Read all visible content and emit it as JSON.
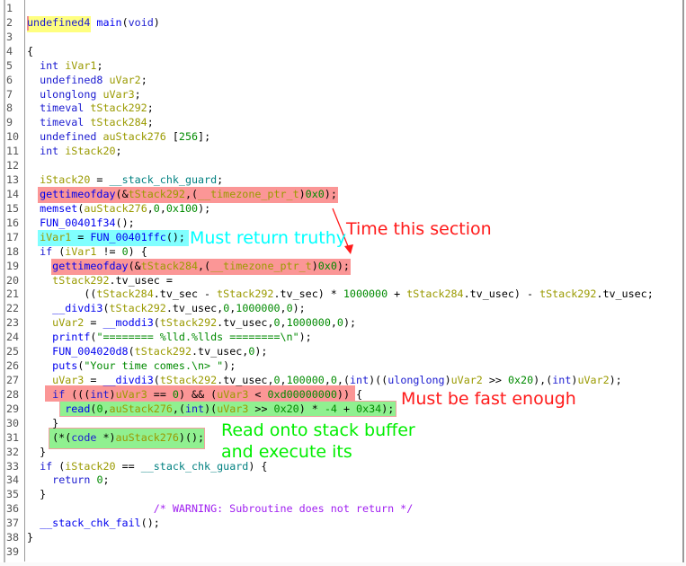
{
  "colors": {
    "keyword": "#1b1bd0",
    "function": "#0000ee",
    "variable": "#9a9a00",
    "number": "#008a00",
    "global": "#008080",
    "comment": "#a020f0",
    "note_red": "#ff1a1a",
    "note_cyan": "#00ffff",
    "note_green": "#00ee00"
  },
  "lines": [
    [],
    [
      [
        "k",
        "undefined4"
      ],
      [
        "p",
        " "
      ],
      [
        "f",
        "main"
      ],
      [
        "p",
        "("
      ],
      [
        "k",
        "void"
      ],
      [
        "p",
        ")"
      ]
    ],
    [],
    [
      [
        "p",
        "{"
      ]
    ],
    [
      [
        "p",
        "  "
      ],
      [
        "k",
        "int"
      ],
      [
        "p",
        " "
      ],
      [
        "v",
        "iVar1"
      ],
      [
        "p",
        ";"
      ]
    ],
    [
      [
        "p",
        "  "
      ],
      [
        "k",
        "undefined8"
      ],
      [
        "p",
        " "
      ],
      [
        "v",
        "uVar2"
      ],
      [
        "p",
        ";"
      ]
    ],
    [
      [
        "p",
        "  "
      ],
      [
        "k",
        "ulonglong"
      ],
      [
        "p",
        " "
      ],
      [
        "v",
        "uVar3"
      ],
      [
        "p",
        ";"
      ]
    ],
    [
      [
        "p",
        "  "
      ],
      [
        "k",
        "timeval"
      ],
      [
        "p",
        " "
      ],
      [
        "v",
        "tStack292"
      ],
      [
        "p",
        ";"
      ]
    ],
    [
      [
        "p",
        "  "
      ],
      [
        "k",
        "timeval"
      ],
      [
        "p",
        " "
      ],
      [
        "v",
        "tStack284"
      ],
      [
        "p",
        ";"
      ]
    ],
    [
      [
        "p",
        "  "
      ],
      [
        "k",
        "undefined"
      ],
      [
        "p",
        " "
      ],
      [
        "v",
        "auStack276"
      ],
      [
        "p",
        " ["
      ],
      [
        "n",
        "256"
      ],
      [
        "p",
        "];"
      ]
    ],
    [
      [
        "p",
        "  "
      ],
      [
        "k",
        "int"
      ],
      [
        "p",
        " "
      ],
      [
        "v",
        "iStack20"
      ],
      [
        "p",
        ";"
      ]
    ],
    [],
    [
      [
        "p",
        "  "
      ],
      [
        "v",
        "iStack20"
      ],
      [
        "p",
        " = "
      ],
      [
        "g",
        "__stack_chk_guard"
      ],
      [
        "p",
        ";"
      ]
    ],
    [
      [
        "p",
        "  "
      ],
      [
        "f",
        "gettimeofday"
      ],
      [
        "p",
        "(&"
      ],
      [
        "v",
        "tStack292"
      ],
      [
        "p",
        ",("
      ],
      [
        "v",
        "__timezone_ptr_t"
      ],
      [
        "p",
        ")"
      ],
      [
        "n",
        "0x0"
      ],
      [
        "p",
        ");"
      ]
    ],
    [
      [
        "p",
        "  "
      ],
      [
        "f",
        "memset"
      ],
      [
        "p",
        "("
      ],
      [
        "v",
        "auStack276"
      ],
      [
        "p",
        ","
      ],
      [
        "n",
        "0"
      ],
      [
        "p",
        ","
      ],
      [
        "n",
        "0x100"
      ],
      [
        "p",
        ");"
      ]
    ],
    [
      [
        "p",
        "  "
      ],
      [
        "f",
        "FUN_00401f34"
      ],
      [
        "p",
        "();"
      ]
    ],
    [
      [
        "p",
        "  "
      ],
      [
        "v",
        "iVar1"
      ],
      [
        "p",
        " = "
      ],
      [
        "f",
        "FUN_00401ffc"
      ],
      [
        "p",
        "();"
      ]
    ],
    [
      [
        "p",
        "  "
      ],
      [
        "k",
        "if"
      ],
      [
        "p",
        " ("
      ],
      [
        "v",
        "iVar1"
      ],
      [
        "p",
        " != "
      ],
      [
        "n",
        "0"
      ],
      [
        "p",
        ") {"
      ]
    ],
    [
      [
        "p",
        "    "
      ],
      [
        "f",
        "gettimeofday"
      ],
      [
        "p",
        "(&"
      ],
      [
        "v",
        "tStack284"
      ],
      [
        "p",
        ",("
      ],
      [
        "v",
        "__timezone_ptr_t"
      ],
      [
        "p",
        ")"
      ],
      [
        "n",
        "0x0"
      ],
      [
        "p",
        ");"
      ]
    ],
    [
      [
        "p",
        "    "
      ],
      [
        "v",
        "tStack292"
      ],
      [
        "p",
        ".tv_usec ="
      ]
    ],
    [
      [
        "p",
        "         (("
      ],
      [
        "v",
        "tStack284"
      ],
      [
        "p",
        ".tv_sec - "
      ],
      [
        "v",
        "tStack292"
      ],
      [
        "p",
        ".tv_sec) * "
      ],
      [
        "n",
        "1000000"
      ],
      [
        "p",
        " + "
      ],
      [
        "v",
        "tStack284"
      ],
      [
        "p",
        ".tv_usec) - "
      ],
      [
        "v",
        "tStack292"
      ],
      [
        "p",
        ".tv_usec;"
      ]
    ],
    [
      [
        "p",
        "    "
      ],
      [
        "f",
        "__divdi3"
      ],
      [
        "p",
        "("
      ],
      [
        "v",
        "tStack292"
      ],
      [
        "p",
        ".tv_usec,"
      ],
      [
        "n",
        "0"
      ],
      [
        "p",
        ","
      ],
      [
        "n",
        "1000000"
      ],
      [
        "p",
        ","
      ],
      [
        "n",
        "0"
      ],
      [
        "p",
        ");"
      ]
    ],
    [
      [
        "p",
        "    "
      ],
      [
        "v",
        "uVar2"
      ],
      [
        "p",
        " = "
      ],
      [
        "f",
        "__moddi3"
      ],
      [
        "p",
        "("
      ],
      [
        "v",
        "tStack292"
      ],
      [
        "p",
        ".tv_usec,"
      ],
      [
        "n",
        "0"
      ],
      [
        "p",
        ","
      ],
      [
        "n",
        "1000000"
      ],
      [
        "p",
        ","
      ],
      [
        "n",
        "0"
      ],
      [
        "p",
        ");"
      ]
    ],
    [
      [
        "p",
        "    "
      ],
      [
        "f",
        "printf"
      ],
      [
        "p",
        "("
      ],
      [
        "s",
        "\"======== %lld.%llds ========\\n\""
      ],
      [
        "p",
        ");"
      ]
    ],
    [
      [
        "p",
        "    "
      ],
      [
        "f",
        "FUN_004020d8"
      ],
      [
        "p",
        "("
      ],
      [
        "v",
        "tStack292"
      ],
      [
        "p",
        ".tv_usec,"
      ],
      [
        "n",
        "0"
      ],
      [
        "p",
        ");"
      ]
    ],
    [
      [
        "p",
        "    "
      ],
      [
        "f",
        "puts"
      ],
      [
        "p",
        "("
      ],
      [
        "s",
        "\"Your time comes.\\n> \""
      ],
      [
        "p",
        ");"
      ]
    ],
    [
      [
        "p",
        "    "
      ],
      [
        "v",
        "uVar3"
      ],
      [
        "p",
        " = "
      ],
      [
        "f",
        "__divdi3"
      ],
      [
        "p",
        "("
      ],
      [
        "v",
        "tStack292"
      ],
      [
        "p",
        ".tv_usec,"
      ],
      [
        "n",
        "0"
      ],
      [
        "p",
        ","
      ],
      [
        "n",
        "100000"
      ],
      [
        "p",
        ","
      ],
      [
        "n",
        "0"
      ],
      [
        "p",
        ",("
      ],
      [
        "k",
        "int"
      ],
      [
        "p",
        ")(("
      ],
      [
        "k",
        "ulonglong"
      ],
      [
        "p",
        ")"
      ],
      [
        "v",
        "uVar2"
      ],
      [
        "p",
        " >> "
      ],
      [
        "n",
        "0x20"
      ],
      [
        "p",
        "),("
      ],
      [
        "k",
        "int"
      ],
      [
        "p",
        ")"
      ],
      [
        "v",
        "uVar2"
      ],
      [
        "p",
        ");"
      ]
    ],
    [
      [
        "p",
        "    "
      ],
      [
        "k",
        "if"
      ],
      [
        "p",
        " ((("
      ],
      [
        "k",
        "int"
      ],
      [
        "p",
        ")"
      ],
      [
        "v",
        "uVar3"
      ],
      [
        "p",
        " == "
      ],
      [
        "n",
        "0"
      ],
      [
        "p",
        ") && ("
      ],
      [
        "v",
        "uVar3"
      ],
      [
        "p",
        " < "
      ],
      [
        "n",
        "0xd00000000"
      ],
      [
        "p",
        ")) {"
      ]
    ],
    [
      [
        "p",
        "      "
      ],
      [
        "f",
        "read"
      ],
      [
        "p",
        "("
      ],
      [
        "n",
        "0"
      ],
      [
        "p",
        ","
      ],
      [
        "v",
        "auStack276"
      ],
      [
        "p",
        ",("
      ],
      [
        "k",
        "int"
      ],
      [
        "p",
        ")("
      ],
      [
        "v",
        "uVar3"
      ],
      [
        "p",
        " >> "
      ],
      [
        "n",
        "0x20"
      ],
      [
        "p",
        ") * "
      ],
      [
        "n",
        "-4"
      ],
      [
        "p",
        " + "
      ],
      [
        "n",
        "0x34"
      ],
      [
        "p",
        ");"
      ]
    ],
    [
      [
        "p",
        "    }"
      ]
    ],
    [
      [
        "p",
        "    (*("
      ],
      [
        "k",
        "code"
      ],
      [
        "p",
        " *)"
      ],
      [
        "v",
        "auStack276"
      ],
      [
        "p",
        ")();"
      ]
    ],
    [
      [
        "p",
        "  }"
      ]
    ],
    [
      [
        "p",
        "  "
      ],
      [
        "k",
        "if"
      ],
      [
        "p",
        " ("
      ],
      [
        "v",
        "iStack20"
      ],
      [
        "p",
        " == "
      ],
      [
        "g",
        "__stack_chk_guard"
      ],
      [
        "p",
        ") {"
      ]
    ],
    [
      [
        "p",
        "    "
      ],
      [
        "k",
        "return"
      ],
      [
        "p",
        " "
      ],
      [
        "n",
        "0"
      ],
      [
        "p",
        ";"
      ]
    ],
    [
      [
        "p",
        "  }"
      ]
    ],
    [
      [
        "p",
        "                    "
      ],
      [
        "c",
        "/* WARNING: Subroutine does not return */"
      ]
    ],
    [
      [
        "p",
        "  "
      ],
      [
        "f",
        "__stack_chk_fail"
      ],
      [
        "p",
        "();"
      ]
    ],
    [
      [
        "p",
        "}"
      ]
    ],
    []
  ],
  "annotations": {
    "must_return_truthy": "Must return truthy",
    "time_this_section": "Time this section",
    "must_be_fast_enough": "Must be fast enough",
    "read_onto_stack_line1": "Read onto stack buffer",
    "read_onto_stack_line2": "and execute its"
  }
}
